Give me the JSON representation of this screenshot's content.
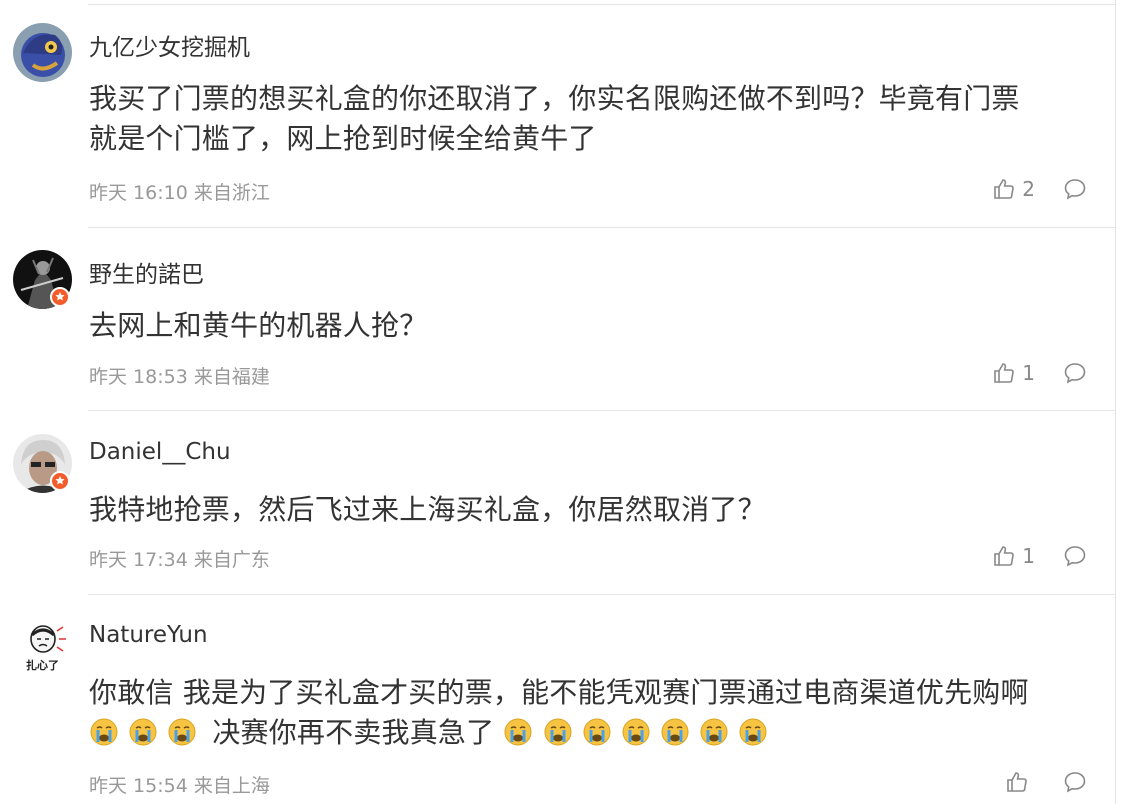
{
  "comments": [
    {
      "username": "九亿少女挖掘机",
      "text_line1": "我买了门票的想买礼盒的你还取消了，你实名限购还做不到吗？毕竟有门票",
      "text_line2": "就是个门槛了，网上抢到时候全给黄牛了",
      "time": "昨天 16:10 来自浙江",
      "likes": "2",
      "verified": false
    },
    {
      "username": "野生的諾巴",
      "text_line1": "去网上和黄牛的机器人抢？",
      "time": "昨天 18:53 来自福建",
      "likes": "1",
      "verified": true
    },
    {
      "username": "Daniel__Chu",
      "text_line1": "我特地抢票，然后飞过来上海买礼盒，你居然取消了？",
      "time": "昨天 17:34 来自广东",
      "likes": "1",
      "verified": true
    },
    {
      "username": "NatureYun",
      "text_line1": "你敢信 我是为了买礼盒才买的票，能不能凭观赛门票通过电商渠道优先购啊",
      "text_line2_after_emoji": "决赛你再不卖我真急了",
      "avatar_caption": "扎心了",
      "time": "昨天 15:54 来自上海",
      "likes": "",
      "verified": false
    }
  ],
  "icons": {
    "like": "thumbs-up-icon",
    "reply": "comment-bubble-icon",
    "emoji": "crying-face-emoji",
    "verified": "verified-badge-icon"
  },
  "colors": {
    "text": "#333333",
    "meta": "#999999",
    "badge": "#f25c2b",
    "emoji_face": "#f6c342",
    "emoji_tears": "#4aa3e8"
  }
}
